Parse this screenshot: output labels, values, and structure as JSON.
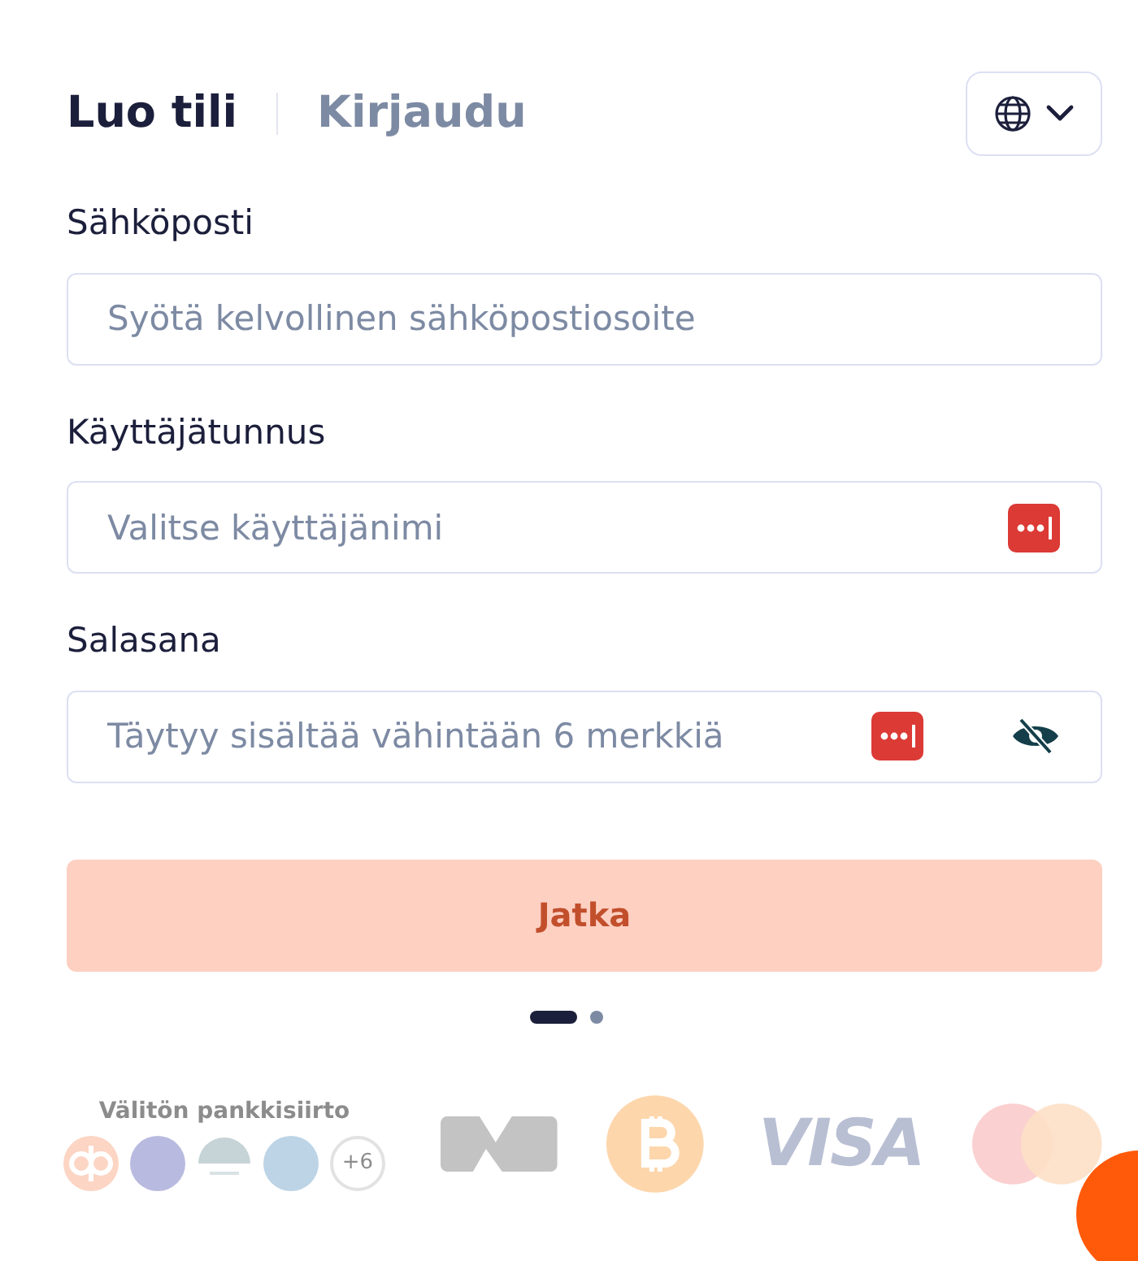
{
  "tabs": [
    {
      "label": "Luo tili",
      "selected": true
    },
    {
      "label": "Kirjaudu",
      "selected": false
    }
  ],
  "fields": [
    {
      "label": "Sähköposti",
      "placeholder": "Syötä kelvollinen sähköpostiosoite",
      "password_manager": false,
      "reveal": false
    },
    {
      "label": "Käyttäjätunnus",
      "placeholder": "Valitse käyttäjänimi",
      "password_manager": true,
      "reveal": false
    },
    {
      "label": "Salasana",
      "placeholder": "Täytyy sisältää vähintään 6 merkkiä",
      "password_manager": true,
      "reveal": true
    }
  ],
  "submit": {
    "label": "Jatka",
    "disabled": true
  },
  "pager": [
    {
      "selected": true
    },
    {
      "selected": false
    }
  ],
  "payments": {
    "bank_title": "Välitön pankkisiirto",
    "more_banks": "+6",
    "card_brand": "VISA"
  }
}
